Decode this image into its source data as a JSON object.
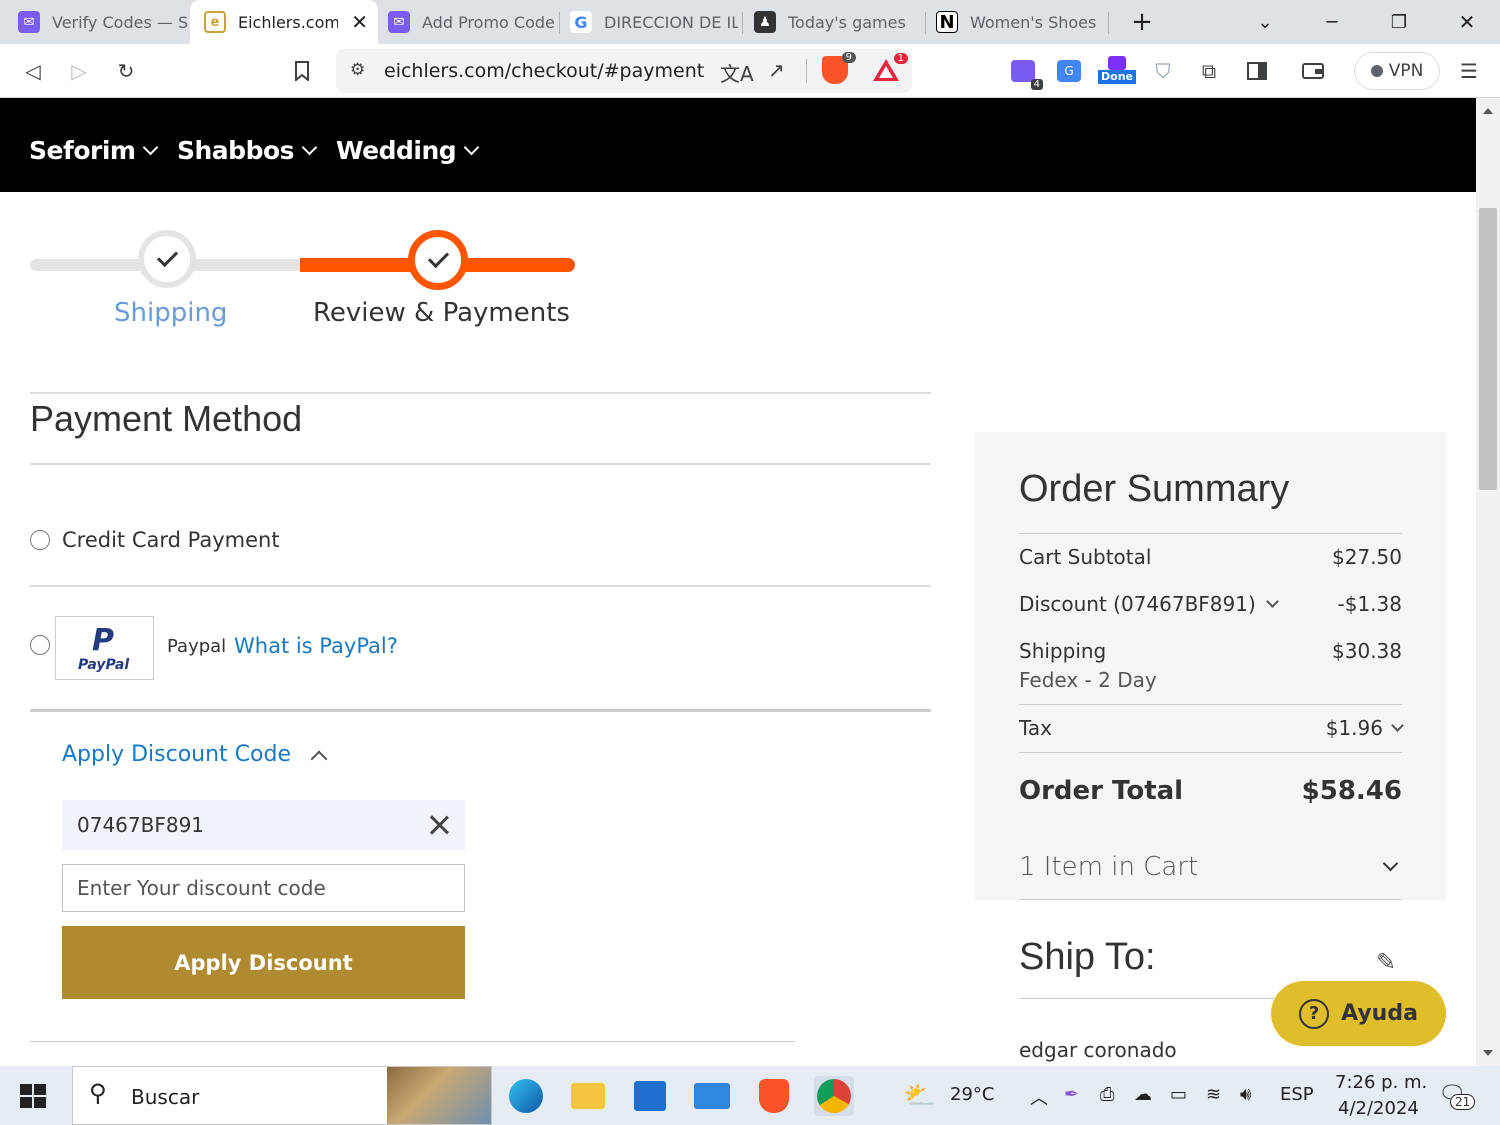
{
  "browser": {
    "tabs": [
      {
        "title": "Verify Codes — S",
        "icon": "mail-icon",
        "color": "#7b5cf0"
      },
      {
        "title": "Eichlers.com",
        "icon": "eichlers-icon",
        "color": "#c9a23a"
      },
      {
        "title": "Add Promo Code",
        "icon": "mail-icon",
        "color": "#7b5cf0"
      },
      {
        "title": "DIRECCION DE IL",
        "icon": "google-icon",
        "color": "#4285f4"
      },
      {
        "title": "Today's games",
        "icon": "chess-icon",
        "color": "#333333"
      },
      {
        "title": "Women's Shoes",
        "icon": "notion-icon",
        "color": "#000000"
      }
    ],
    "url": "eichlers.com/checkout/#payment",
    "brave_badge": "9",
    "alert_badge": "1",
    "ext_badge": "4",
    "done_badge": "Done",
    "vpn_label": "VPN"
  },
  "nav": {
    "items": [
      "Seforim",
      "Shabbos",
      "Wedding"
    ]
  },
  "progress": {
    "step1": "Shipping",
    "step2": "Review & Payments"
  },
  "payment": {
    "title": "Payment Method",
    "credit_card_label": "Credit Card Payment",
    "paypal_label": "Paypal",
    "paypal_link": "What is PayPal?",
    "paypal_logo_text": "PayPal",
    "discount_toggle": "Apply Discount Code",
    "applied_code": "07467BF891",
    "code_placeholder": "Enter Your discount code",
    "apply_button": "Apply Discount"
  },
  "summary": {
    "title": "Order Summary",
    "rows": [
      {
        "label": "Cart Subtotal",
        "value": "$27.50"
      },
      {
        "label": "Discount (07467BF891)",
        "value": "-$1.38"
      },
      {
        "label": "Shipping",
        "sublabel": "Fedex - 2 Day",
        "value": "$30.38"
      },
      {
        "label": "Tax",
        "value": "$1.96"
      }
    ],
    "total_label": "Order Total",
    "total_value": "$58.46",
    "items_in_cart": "1 Item in Cart",
    "ship_to": "Ship To:",
    "ship_name": "edgar coronado",
    "help_button": "Ayuda"
  },
  "taskbar": {
    "search_placeholder": "Buscar",
    "weather": "29°C",
    "language": "ESP",
    "time": "7:26 p. m.",
    "date": "4/2/2024",
    "notifications": "21"
  },
  "colors": {
    "accent_orange": "#ff5501",
    "link_blue": "#1979c3",
    "apply_gold": "#b08a30",
    "help_yellow": "#e0bd2a"
  }
}
